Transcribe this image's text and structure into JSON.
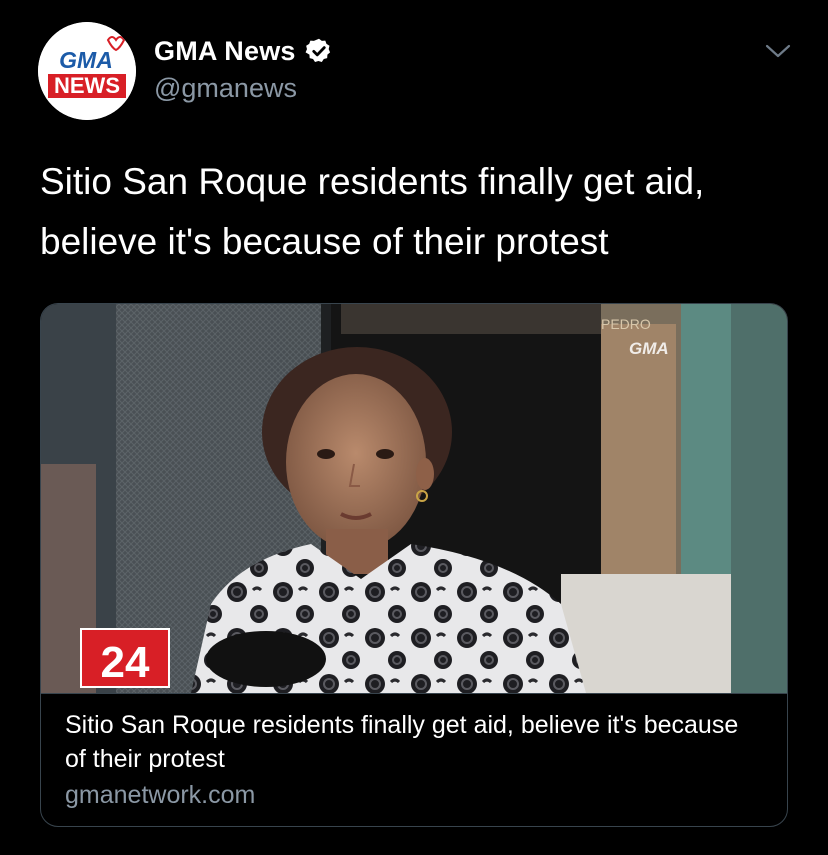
{
  "account": {
    "display_name": "GMA News",
    "handle": "@gmanews",
    "verified": true,
    "avatar_logo_text": [
      "GMA",
      "NEWS"
    ]
  },
  "tweet": {
    "text": "Sitio San Roque residents finally get aid, believe it's because of their protest"
  },
  "card": {
    "title": "Sitio San Roque residents finally get aid, believe it's because of their protest",
    "domain": "gmanetwork.com",
    "image_overlay": {
      "channel_number": "24",
      "watermark": "GMA",
      "sign_text": "PEDRO"
    }
  },
  "colors": {
    "background": "#000000",
    "text_primary": "#ffffff",
    "text_secondary": "#8b98a5",
    "border": "#38444d",
    "gma_red": "#d81f26",
    "gma_blue": "#1c5ba8",
    "badge_white": "#ffffff"
  },
  "icons": [
    "verified-badge-icon",
    "chevron-down-icon"
  ]
}
